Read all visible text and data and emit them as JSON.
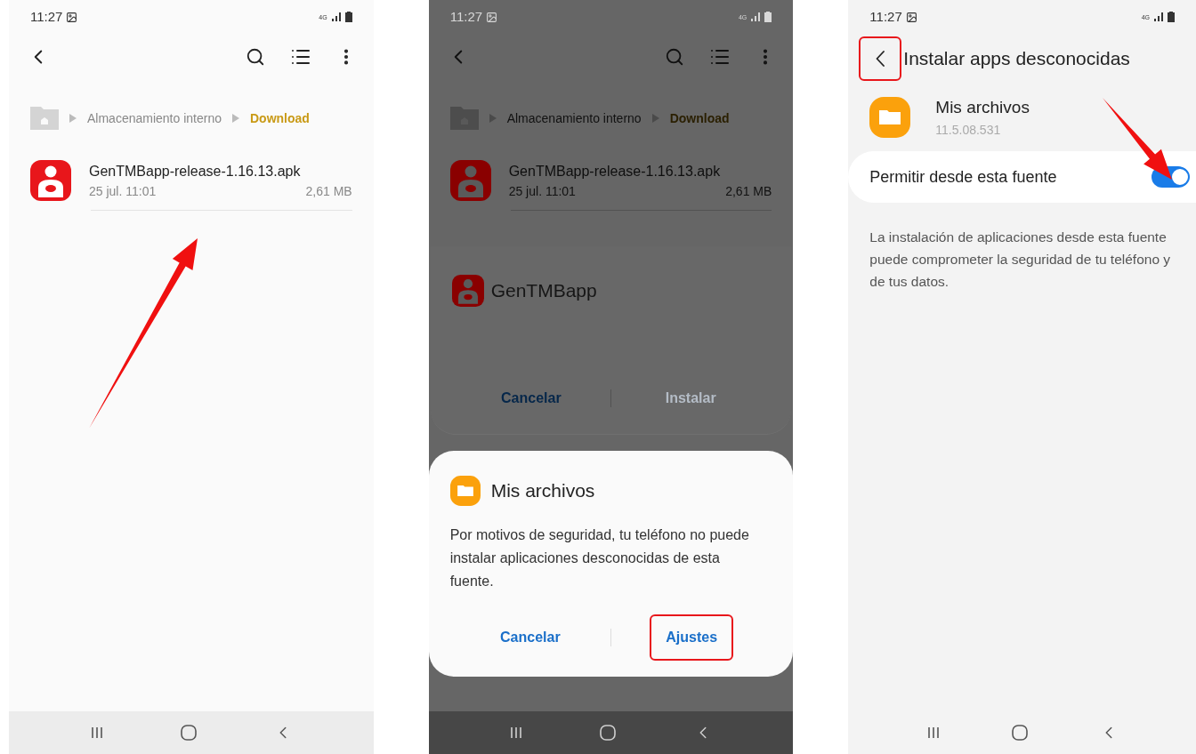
{
  "screens": [
    {
      "kind": "file_list",
      "dimmed": false,
      "pointer_arrow": true,
      "status_bar": {
        "time": "11:27",
        "network": "4G"
      },
      "breadcrumb": [
        "Almacenamiento interno",
        "Download"
      ],
      "files": [
        {
          "name": "GenTMBapp-release-1.16.13.apk",
          "date": "25 jul. 11:01",
          "size": "2,61 MB"
        }
      ]
    },
    {
      "kind": "file_list",
      "dimmed": true,
      "pointer_arrow": false,
      "status_bar": {
        "time": "11:27",
        "network": "4G"
      },
      "breadcrumb": [
        "Almacenamiento interno",
        "Download"
      ],
      "files": [
        {
          "name": "GenTMBapp-release-1.16.13.apk",
          "date": "25 jul. 11:01",
          "size": "2,61 MB"
        }
      ],
      "install_sheet": {
        "app_name": "GenTMBapp",
        "buttons": [
          {
            "label": "Cancelar",
            "disabled": false
          },
          {
            "label": "Instalar",
            "disabled": true
          }
        ]
      },
      "dialog": {
        "title": "Mis archivos",
        "message": "Por motivos de seguridad, tu teléfono no puede instalar aplicaciones desconocidas de esta fuente.",
        "buttons": [
          {
            "label": "Cancelar",
            "highlighted": false
          },
          {
            "label": "Ajustes",
            "highlighted": true
          }
        ]
      }
    },
    {
      "kind": "settings",
      "pointer_arrow": true,
      "status_bar": {
        "time": "11:27",
        "network": "4G"
      },
      "title": "Instalar apps desconocidas",
      "back_highlighted": true,
      "app": {
        "name": "Mis archivos",
        "version": "11.5.08.531"
      },
      "toggle": {
        "label": "Permitir desde esta fuente",
        "on": true
      },
      "description": "La instalación de aplicaciones desde esta fuente puede comprometer la seguridad de tu teléfono y de tus datos."
    }
  ]
}
